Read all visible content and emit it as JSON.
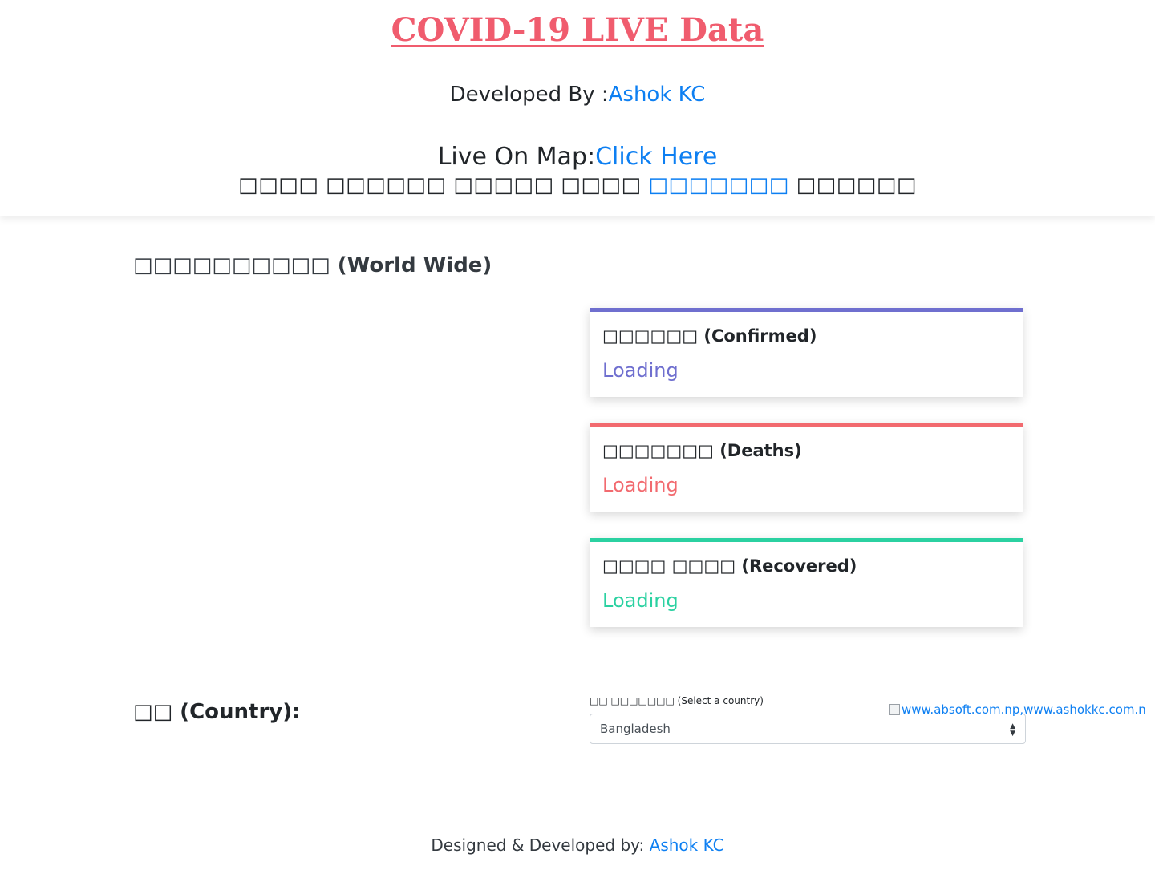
{
  "header": {
    "title": "COVID-19 LIVE Data",
    "developed_by_label": "Developed By :",
    "developer_name": "Ashok KC",
    "map_label": "Live On Map:",
    "map_link": "Click Here",
    "nepali_prefix": "□□□□ □□□□□□ □□□□□ □□□□",
    "nepali_link": "□□□□□□□",
    "nepali_suffix": "□□□□□□"
  },
  "worldwide": {
    "title": "□□□□□□□□□□ (World Wide)",
    "cards": [
      {
        "label": "□□□□□□ (Confirmed)",
        "value": "Loading",
        "color": "#6f6fcf"
      },
      {
        "label": "□□□□□□□ (Deaths)",
        "value": "Loading",
        "color": "#f26a6f"
      },
      {
        "label": "□□□□ □□□□ (Recovered)",
        "value": "Loading",
        "color": "#2bd1a1"
      }
    ]
  },
  "country": {
    "heading": "□□ (Country):",
    "select_label": "□□ □□□□□□□ (Select a country)",
    "selected": "Bangladesh"
  },
  "ad": {
    "alt_text": "www.absoft.com.np,www.ashokkc.com.np"
  },
  "footer": {
    "text": "Designed & Developed by: ",
    "link": "Ashok KC"
  },
  "colors": {
    "title": "#f05c6e",
    "link": "#0d7ff2"
  }
}
